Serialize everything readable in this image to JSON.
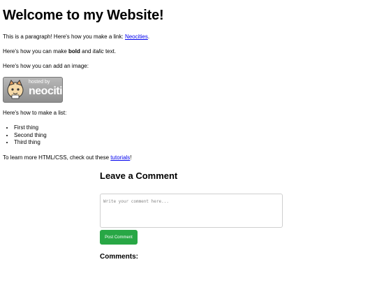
{
  "heading": "Welcome to my Website!",
  "p1": {
    "before": "This is a paragraph! Here's how you make a link: ",
    "link": "Neocities",
    "after": "."
  },
  "p2": {
    "before": "Here's how you can make ",
    "bold": "bold",
    "middle": " and ",
    "italic": "italic",
    "after": " text."
  },
  "p3": "Here's how you can add an image:",
  "image": {
    "hosted_by": "hosted by",
    "brand": "neocities"
  },
  "p4": "Here's how to make a list:",
  "list": [
    "First thing",
    "Second thing",
    "Third thing"
  ],
  "p5": {
    "before": "To learn more HTML/CSS, check out these ",
    "link": "tutorials",
    "after": "!"
  },
  "comments": {
    "title": "Leave a Comment",
    "placeholder": "Write your comment here...",
    "button": "Post Comment",
    "list_title": "Comments:"
  },
  "colors": {
    "link": "#0000ee",
    "button": "#28a745"
  }
}
